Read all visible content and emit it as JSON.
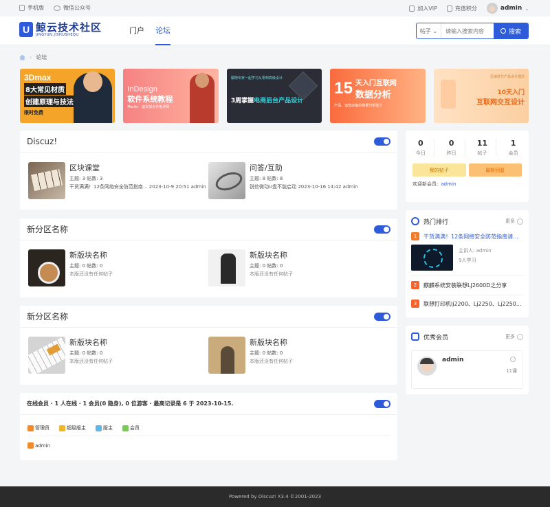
{
  "topbar": {
    "mobile": "手机版",
    "wechat": "微信公众号",
    "vip": "加入VIP",
    "recharge": "充值积分",
    "user": "admin"
  },
  "header": {
    "logo_cn": "鲸云技术社区",
    "logo_en": "JINGYUN.JISHUSHEQU",
    "nav": [
      "门户",
      "论坛"
    ],
    "search_category": "帖子",
    "search_placeholder": "请输入搜索内容",
    "search_button": "搜索"
  },
  "breadcrumb": "论坛",
  "banners": {
    "b1": {
      "l1": "3Dmax",
      "l2": "8大常见材质",
      "l3": "创建原理与技法",
      "l4": "限时免费"
    },
    "b2": {
      "l1": "InDesign",
      "l2": "软件系统教程",
      "l3": "Martin · 迪文部合作金讲师"
    },
    "b3": {
      "l0": "跟随专家一起学习从零到高级设计",
      "l1a": "3周掌握",
      "l1b": "电商后台产品设计"
    },
    "b4": {
      "num": "15",
      "l1": "天入门互联网",
      "l2": "数据分析",
      "sub": "产品、运营必备的数据分析能力"
    },
    "b5": {
      "l0": "迅速迭代产品设计理念",
      "l1": "10天入门",
      "l2": "互联网交互设计"
    }
  },
  "sections": [
    {
      "title": "Discuz!",
      "forums": [
        {
          "name": "区块课堂",
          "meta": "主题: 3 帖数: 3",
          "last": "干货满满！12条网络安全防范指南... 2023-10-9 20:51 admin"
        },
        {
          "name": "问答/互助",
          "meta": "主题: 8 帖数: 8",
          "last": "锐信微动U盘不能启动 2023-10-16 14:42 admin"
        }
      ]
    },
    {
      "title": "新分区名称",
      "forums": [
        {
          "name": "新版块名称",
          "meta": "主题: 0 帖数: 0",
          "last": "本版还没有任何帖子"
        },
        {
          "name": "新版块名称",
          "meta": "主题: 0 帖数: 0",
          "last": "本版还没有任何帖子"
        }
      ]
    },
    {
      "title": "新分区名称",
      "forums": [
        {
          "name": "新版块名称",
          "meta": "主题: 0 帖数: 0",
          "last": "本版还没有任何帖子"
        },
        {
          "name": "新版块名称",
          "meta": "主题: 0 帖数: 0",
          "last": "本版还没有任何帖子"
        }
      ]
    }
  ],
  "online": {
    "summary": "在线会员 · 1 人在线 · 1 会员(0 隐身), 0 位游客 · 最高记录是 6 于 2023-10-15.",
    "legend": [
      "管理员",
      "超级版主",
      "版主",
      "会员"
    ],
    "users": [
      "admin"
    ]
  },
  "stats": {
    "items": [
      {
        "n": "0",
        "l": "今日"
      },
      {
        "n": "0",
        "l": "昨日"
      },
      {
        "n": "11",
        "l": "帖子"
      },
      {
        "n": "1",
        "l": "会员"
      }
    ],
    "btn_my": "我的帖子",
    "btn_latest": "最新回复",
    "welcome": "欢迎新会员:",
    "new_member": "admin"
  },
  "hot": {
    "title": "热门排行",
    "more": "更多",
    "items": [
      {
        "rank": "1",
        "title": "干货满满！12条网络安全防范指南请..."
      },
      {
        "rank": "2",
        "title": "麒麟系统安装联想LJ2600D之分享"
      },
      {
        "rank": "3",
        "title": "联想打印机lj2200、Lj2250、Lj2250..."
      }
    ],
    "lecturer": "主讲人: admin",
    "learners": "9人学习"
  },
  "members": {
    "title": "优秀会员",
    "more": "更多",
    "name": "admin",
    "count": "11课"
  },
  "footer": "Powered by  Discuz! X3.4 ©2001-2023"
}
